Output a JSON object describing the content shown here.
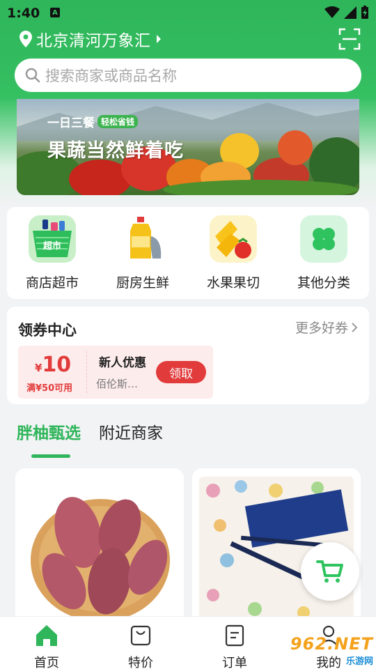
{
  "status": {
    "time": "1:40",
    "notif_letter": "A"
  },
  "header": {
    "location": "北京清河万象汇",
    "search_placeholder": "搜索商家或商品名称"
  },
  "banner": {
    "subtitle": "一日三餐",
    "badge": "轻松省钱",
    "title": "果蔬当然鲜着吃"
  },
  "categories": [
    {
      "label": "商店超市",
      "icon": "supermarket-basket-icon",
      "icon_text": "超市"
    },
    {
      "label": "厨房生鲜",
      "icon": "cooking-oil-fish-icon"
    },
    {
      "label": "水果果切",
      "icon": "pineapple-strawberry-icon"
    },
    {
      "label": "其他分类",
      "icon": "four-leaf-grid-icon"
    }
  ],
  "coupons": {
    "title": "领券中心",
    "more": "更多好券",
    "item": {
      "currency": "¥",
      "amount": "10",
      "condition": "满¥50可用",
      "name": "新人优惠",
      "shop": "佰伦斯…",
      "button": "领取"
    }
  },
  "tabs": [
    {
      "label": "胖柚甄选",
      "active": true
    },
    {
      "label": "附近商家",
      "active": false
    }
  ],
  "products": [
    {
      "image": "sweet-potatoes-photo"
    },
    {
      "image": "pen-box-photo"
    }
  ],
  "bottom_nav": [
    {
      "label": "首页",
      "icon": "home-icon",
      "active": true
    },
    {
      "label": "特价",
      "icon": "bag-icon",
      "active": false
    },
    {
      "label": "订单",
      "icon": "order-icon",
      "active": false
    },
    {
      "label": "我的",
      "icon": "profile-icon",
      "active": false
    }
  ],
  "watermark": {
    "main": "962.NET",
    "sub": "乐游网"
  },
  "colors": {
    "brand_green": "#2fb55a",
    "coupon_red": "#e23b3b"
  }
}
